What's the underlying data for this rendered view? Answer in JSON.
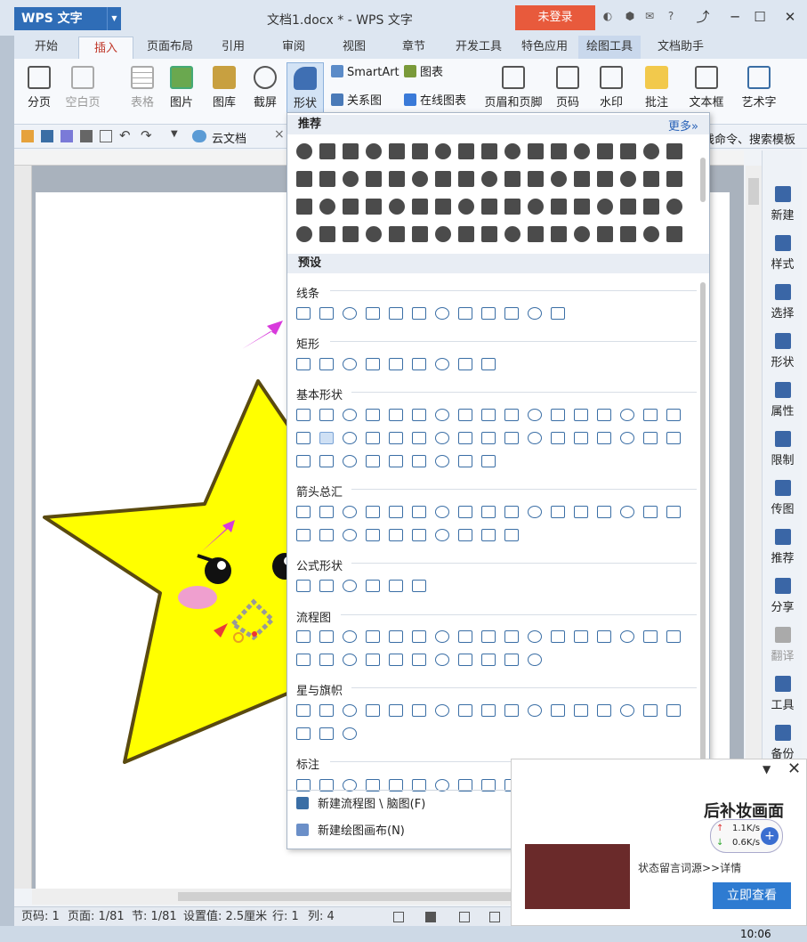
{
  "titlebar": {
    "app_name": "WPS 文字",
    "doc_title": "文档1.docx * - WPS 文字",
    "login_label": "未登录",
    "min_label": "─",
    "max_label": "☐",
    "close_label": "✕"
  },
  "tabs": [
    "开始",
    "插入",
    "页面布局",
    "引用",
    "审阅",
    "视图",
    "章节",
    "开发工具",
    "特色应用",
    "绘图工具",
    "文档助手"
  ],
  "ribbon": {
    "page_break": "分页",
    "blank_page": "空白页",
    "table": "表格",
    "picture": "图片",
    "gallery": "图库",
    "screenshot": "截屏",
    "shapes": "形状",
    "smartart": "SmartArt",
    "chart": "图表",
    "relation": "关系图",
    "online_chart": "在线图表",
    "header_footer": "页眉和页脚",
    "page_number": "页码",
    "watermark": "水印",
    "comment": "批注",
    "textbox": "文本框",
    "wordart": "艺术字"
  },
  "quickaccess": {
    "cloud_doc": "云文档",
    "right_hint": "线命令、搜索模板"
  },
  "panel": {
    "recommended_header": "推荐",
    "more_label": "更多»",
    "preset_header": "预设",
    "categories": [
      "线条",
      "矩形",
      "基本形状",
      "箭头总汇",
      "公式形状",
      "流程图",
      "星与旗帜",
      "标注"
    ],
    "footer_flowchart": "新建流程图 \\ 脑图(F)",
    "footer_canvas": "新建绘图画布(N)"
  },
  "sidebar": [
    "新建",
    "样式",
    "选择",
    "形状",
    "属性",
    "限制",
    "传图",
    "推荐",
    "分享",
    "翻译",
    "工具",
    "备份"
  ],
  "statusbar": {
    "page_code": "页码: 1",
    "pages": "页面: 1/81",
    "section": "节: 1/81",
    "setting": "设置值: 2.5厘米",
    "row": "行: 1",
    "col": "列: 4"
  },
  "popup": {
    "title": "后补妆画面",
    "desc": "状态留言词源>>详情",
    "button": "立即查看",
    "net_up": "1.1K/s",
    "net_down": "0.6K/s"
  },
  "taskbar": {
    "time": "10:06"
  },
  "colors": {
    "star_fill": "#ffff00",
    "star_stroke": "#5a4a10",
    "accent": "#2f6db7",
    "arrow": "#d83adc"
  }
}
